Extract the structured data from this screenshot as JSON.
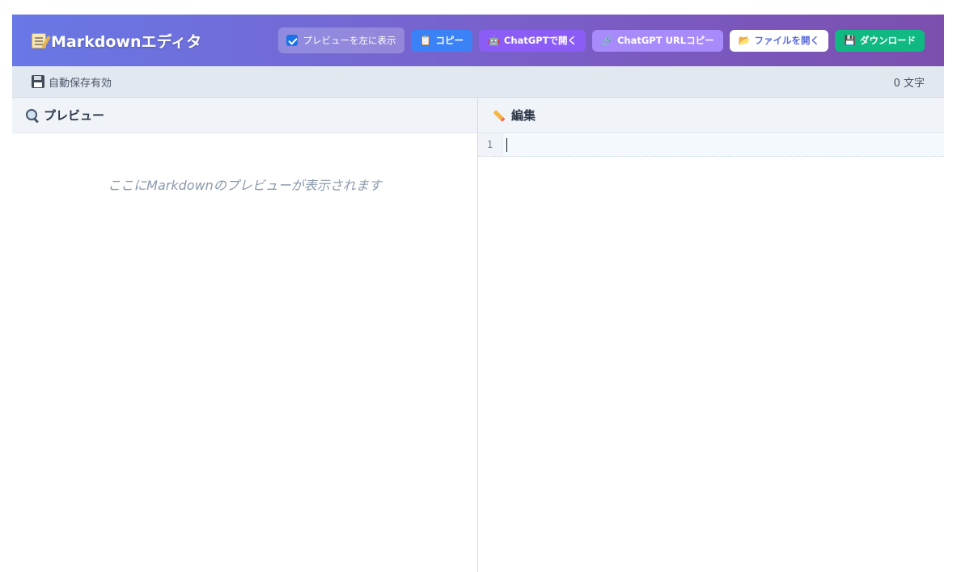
{
  "app": {
    "title": "Markdownエディタ"
  },
  "toolbar": {
    "toggle_label": "プレビューを左に表示",
    "toggle_checked": true,
    "copy_label": "コピー",
    "chatgpt_label": "ChatGPTで開く",
    "url_copy_label": "ChatGPT URLコピー",
    "open_file_label": "ファイルを開く",
    "download_label": "ダウンロード"
  },
  "status": {
    "autosave": "自動保存有効",
    "char_count": "0 文字"
  },
  "preview": {
    "heading": "プレビュー",
    "placeholder": "ここにMarkdownのプレビューが表示されます"
  },
  "editor": {
    "heading": "編集",
    "line_numbers": [
      "1"
    ],
    "content": ""
  },
  "colors": {
    "header_start": "#6878e6",
    "header_end": "#7b4fae",
    "copy": "#3b82f6",
    "chatgpt": "#8b5cf6",
    "url_copy": "#a78bfa",
    "download": "#10b981"
  }
}
